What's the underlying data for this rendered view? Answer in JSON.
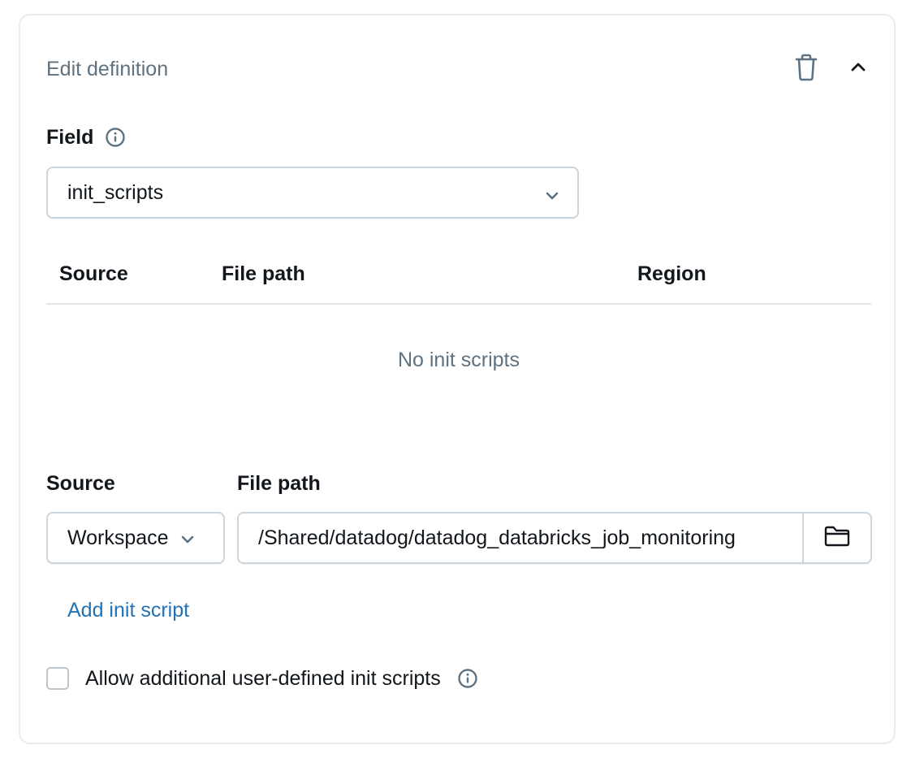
{
  "header": {
    "title": "Edit definition",
    "delete_icon": "trash-icon",
    "collapse_icon": "chevron-up-icon"
  },
  "field": {
    "label": "Field",
    "info_icon": "info-icon",
    "selected_value": "init_scripts"
  },
  "table": {
    "columns": [
      "Source",
      "File path",
      "Region"
    ],
    "empty_message": "No init scripts"
  },
  "new_script": {
    "source_label": "Source",
    "path_label": "File path",
    "source_value": "Workspace",
    "path_value": "/Shared/datadog/datadog_databricks_job_monitoring",
    "browse_icon": "folder-icon"
  },
  "add_link": "Add init script",
  "allow_checkbox": {
    "label": "Allow additional user-defined init scripts",
    "checked": false
  },
  "colors": {
    "link": "#2272b4",
    "muted_text": "#5f7281",
    "border": "#cbd5dd",
    "card_border": "#e8ecf0"
  }
}
